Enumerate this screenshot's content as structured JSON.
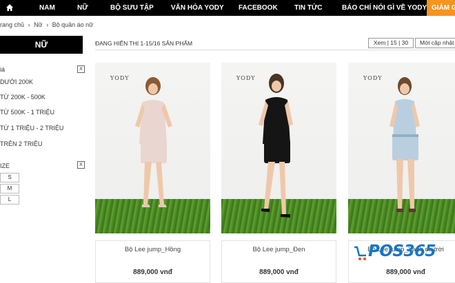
{
  "nav": {
    "items": [
      "NAM",
      "NỮ",
      "BỘ SƯU TẬP",
      "VĂN HÓA YODY",
      "FACEBOOK",
      "TIN TỨC",
      "BÁO CHÍ NÓI GÌ VỀ YODY"
    ],
    "promo": "GIẢM G",
    "home_icon": "home-icon"
  },
  "breadcrumb": [
    "rang chủ",
    "›",
    "Nữ",
    "›",
    "Bộ quần áo nữ"
  ],
  "sidebar": {
    "title": "NỮ",
    "price_heading": "iá",
    "price_options": [
      "DƯỚI 200K",
      "TỪ 200K - 500K",
      "TỪ 500K - 1 TRIỆU",
      "TỪ 1 TRIỆU - 2 TRIỆU",
      "TRÊN 2 TRIỆU"
    ],
    "size_heading": "IZE",
    "sizes": [
      "S",
      "M",
      "L"
    ],
    "clear_symbol": "X"
  },
  "listing": {
    "count_text": "ĐANG HIỂN THỊ 1-15/16 SẢN PHẨM",
    "view_text": "Xem | 15 | 30",
    "sort_text": "Mới cập nhật"
  },
  "products": [
    {
      "name": "Bộ Lee jump_Hồng",
      "price": "889,000 vnđ",
      "logo": "YODY",
      "outfit_color": "#e9d6d0"
    },
    {
      "name": "Bộ Lee jump_Đen",
      "price": "889,000 vnđ",
      "logo": "YODY",
      "outfit_color": "#151515"
    },
    {
      "name": "Bộ Lee jump_Xanh da trời",
      "price": "889,000 vnđ",
      "logo": "YODY",
      "outfit_color": "#b9cfdf"
    }
  ],
  "watermark": {
    "text": "POS365"
  }
}
